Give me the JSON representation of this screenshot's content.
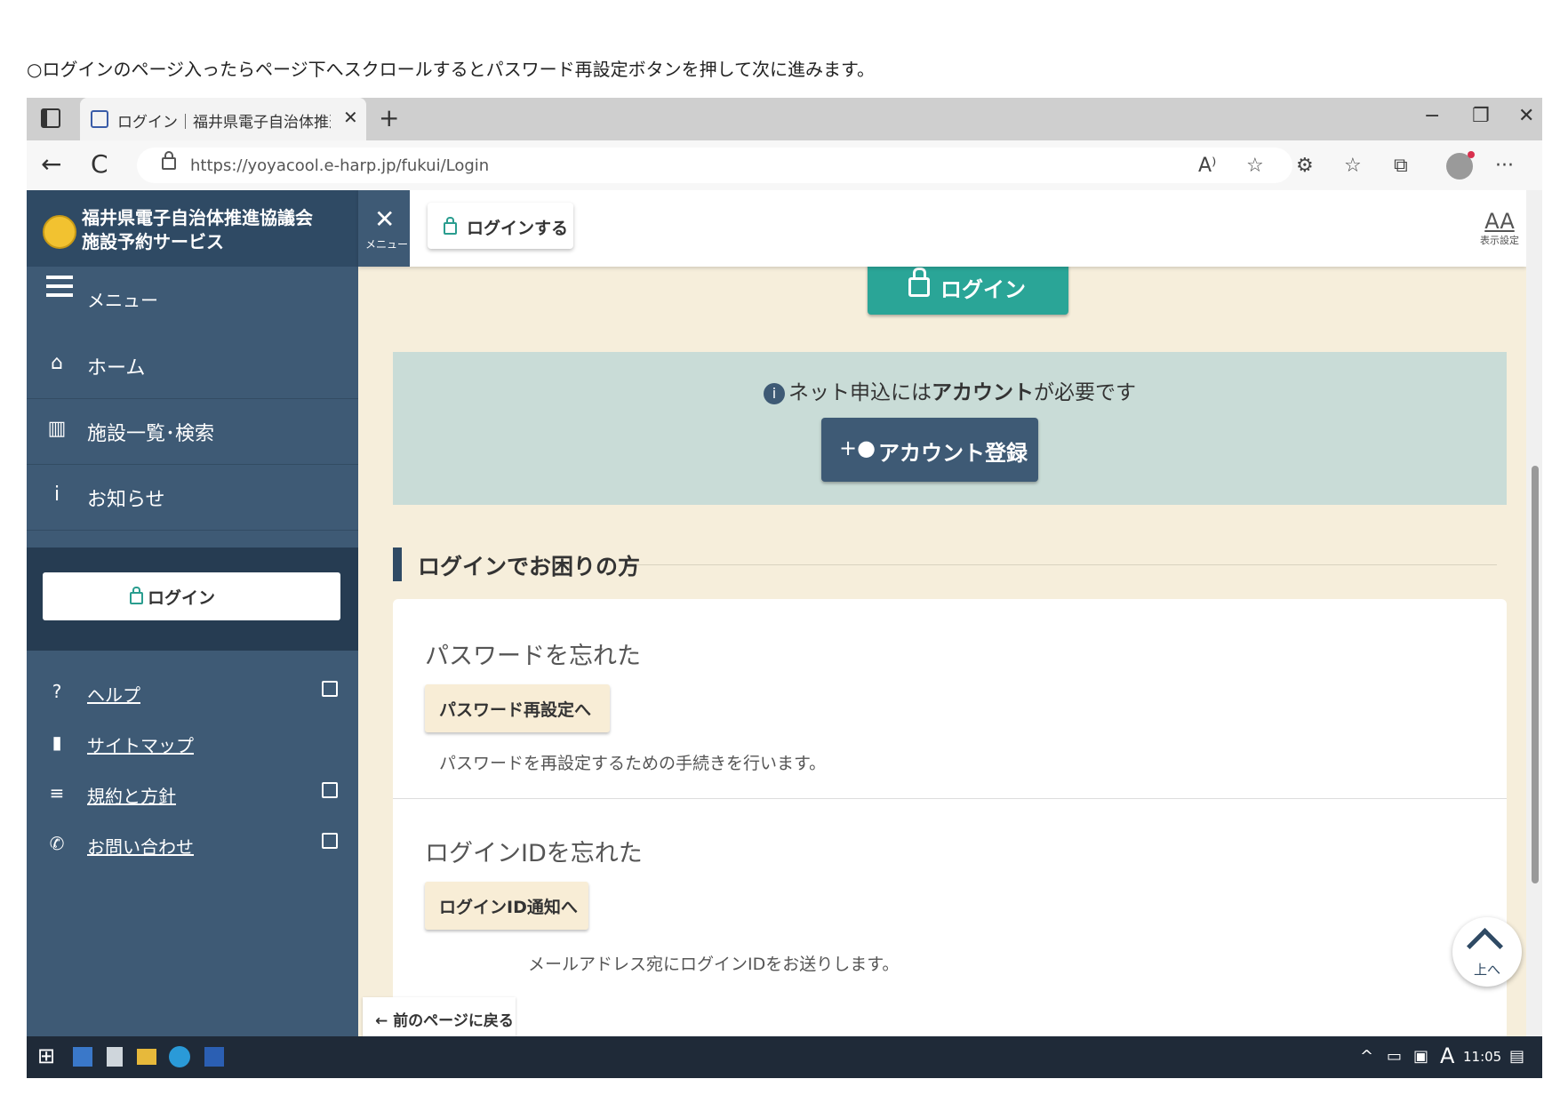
{
  "instruction": "○ログインのページ入ったらページ下へスクロールするとパスワード再設定ボタンを押して次に進みます。",
  "browser": {
    "tab_title": "ログイン｜福井県電子自治体推進",
    "new_tab": "+",
    "minimize": "−",
    "restore": "❐",
    "close": "✕",
    "back": "←",
    "reload": "C",
    "url": "https://yoyacool.e-harp.jp/fukui/Login",
    "toolbar_icons": [
      "read-aloud-icon",
      "add-favorite-icon",
      "extensions-icon",
      "favorites-icon",
      "collections-icon",
      "profile-icon",
      "more-icon"
    ],
    "read_aloud": "A⁾",
    "more": "···"
  },
  "site": {
    "title_line1": "福井県電子自治体推進協議会",
    "title_line2": "施設予約サービス",
    "menu_close_label": "メニュー",
    "header_login": "ログインする",
    "display_settings_big": "AA",
    "display_settings": "表示設定"
  },
  "sidebar": {
    "menu_label": "メニュー",
    "nav": [
      {
        "label": "ホーム",
        "icon": "home-icon",
        "glyph": "⌂"
      },
      {
        "label": "施設一覧･検索",
        "icon": "building-icon",
        "glyph": "▥"
      },
      {
        "label": "お知らせ",
        "icon": "info-icon",
        "glyph": "i"
      }
    ],
    "login_button": "ログイン",
    "links": [
      {
        "label": "ヘルプ",
        "icon": "help-icon",
        "glyph": "?",
        "external": true
      },
      {
        "label": "サイトマップ",
        "icon": "map-icon",
        "glyph": "▮",
        "external": false
      },
      {
        "label": "規約と方針",
        "icon": "list-icon",
        "glyph": "≡",
        "external": true
      },
      {
        "label": "お問い合わせ",
        "icon": "phone-icon",
        "glyph": "✆",
        "external": true
      }
    ]
  },
  "main": {
    "login_button": "ログイン",
    "notice_pre": "ネット申込には",
    "notice_bold": "アカウント",
    "notice_post": "が必要です",
    "account_button": "アカウント登録",
    "section_title": "ログインでお困りの方",
    "forgot_password": {
      "title": "パスワードを忘れた",
      "button": "パスワード再設定へ",
      "desc": "パスワードを再設定するための手続きを行います。"
    },
    "forgot_id": {
      "title": "ログインIDを忘れた",
      "button": "ログインID通知へ",
      "desc": "メールアドレス宛にログインIDをお送りします。"
    },
    "back_button": "前のページに戻る",
    "to_top": "上へ"
  },
  "taskbar": {
    "clock": "11:05",
    "ime": "A",
    "tray_up": "^"
  },
  "colors": {
    "sidebar": "#3e5a75",
    "accent_teal": "#2aa597",
    "content_bg": "#f6eedb",
    "notice_bg": "#c9dcd7"
  }
}
